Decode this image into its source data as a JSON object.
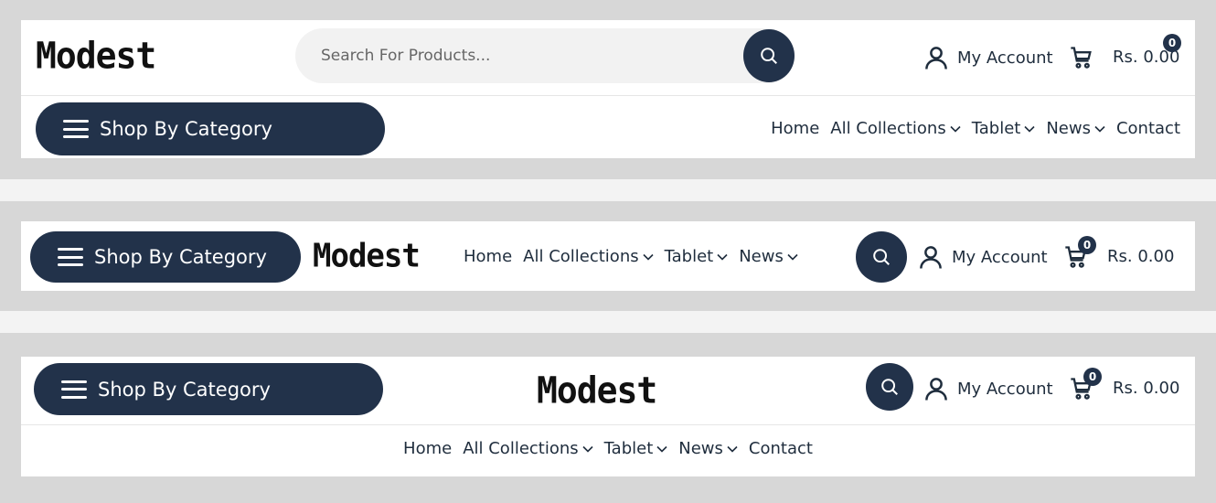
{
  "brand": {
    "logo": "Modest"
  },
  "category_button": {
    "label": "Shop By Category"
  },
  "search": {
    "placeholder": "Search For Products..."
  },
  "account": {
    "label": "My Account"
  },
  "cart": {
    "count": "0",
    "total": "Rs. 0.00"
  },
  "nav": {
    "home": "Home",
    "all_collections": "All Collections",
    "tablet": "Tablet",
    "news": "News",
    "contact": "Contact"
  },
  "colors": {
    "accent": "#22324a",
    "background": "#d7d7d7",
    "card": "#ffffff"
  },
  "icons": {
    "menu": "hamburger-icon",
    "search": "search-icon",
    "account": "user-icon",
    "cart": "cart-icon",
    "dropdown": "chevron-down-icon"
  }
}
